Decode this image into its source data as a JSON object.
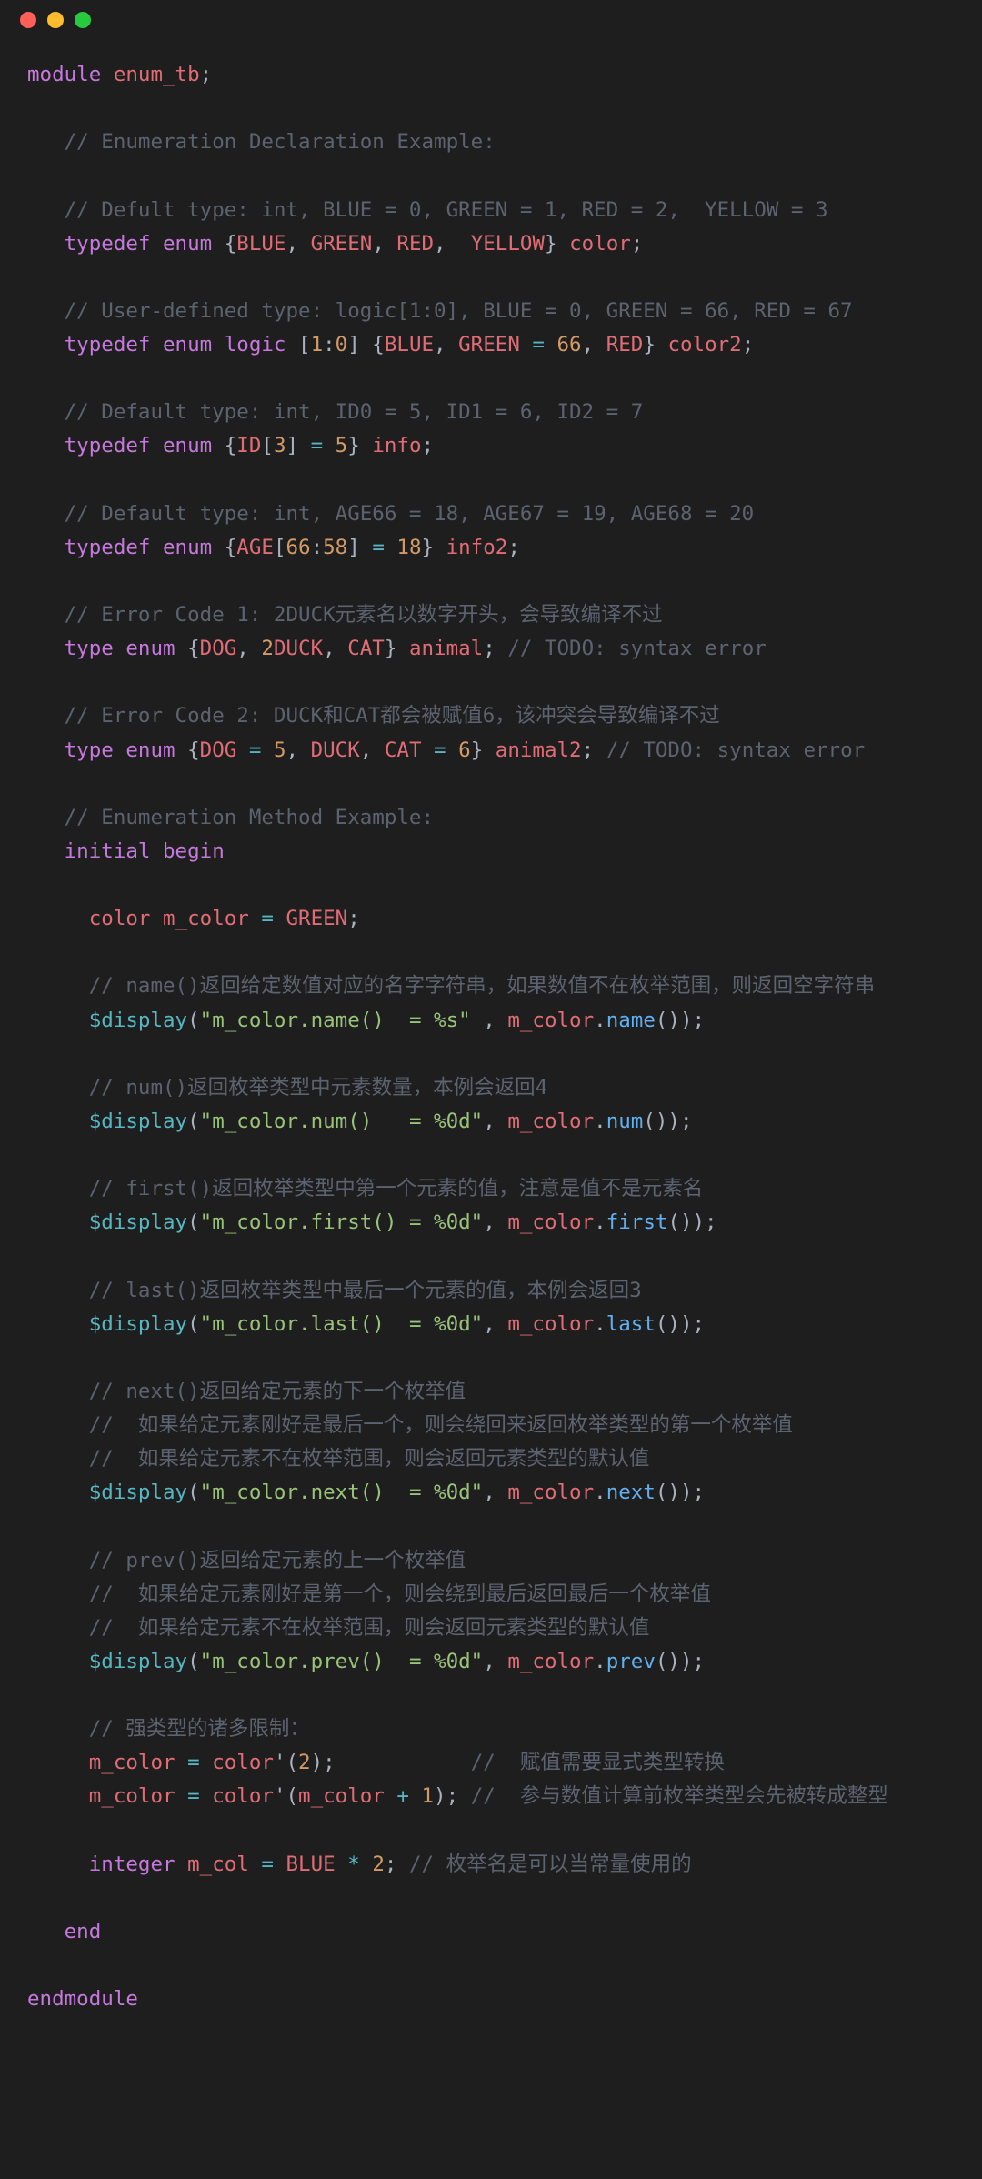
{
  "titlebar": {
    "dots": [
      "red",
      "yellow",
      "green"
    ]
  },
  "code": {
    "lines": [
      [
        [
          "kw",
          "module"
        ],
        [
          "punct",
          " "
        ],
        [
          "ident",
          "enum_tb"
        ],
        [
          "punct",
          ";"
        ]
      ],
      [],
      [
        [
          "punct",
          "   "
        ],
        [
          "comment",
          "// Enumeration Declaration Example:"
        ]
      ],
      [],
      [
        [
          "punct",
          "   "
        ],
        [
          "comment",
          "// Defult type: int, BLUE = 0, GREEN = 1, RED = 2,  YELLOW = 3"
        ]
      ],
      [
        [
          "punct",
          "   "
        ],
        [
          "kw",
          "typedef"
        ],
        [
          "punct",
          " "
        ],
        [
          "kw",
          "enum"
        ],
        [
          "punct",
          " {"
        ],
        [
          "ident",
          "BLUE"
        ],
        [
          "punct",
          ", "
        ],
        [
          "ident",
          "GREEN"
        ],
        [
          "punct",
          ", "
        ],
        [
          "ident",
          "RED"
        ],
        [
          "punct",
          ",  "
        ],
        [
          "ident",
          "YELLOW"
        ],
        [
          "punct",
          "} "
        ],
        [
          "ident",
          "color"
        ],
        [
          "punct",
          ";"
        ]
      ],
      [],
      [
        [
          "punct",
          "   "
        ],
        [
          "comment",
          "// User-defined type: logic[1:0], BLUE = 0, GREEN = 66, RED = 67"
        ]
      ],
      [
        [
          "punct",
          "   "
        ],
        [
          "kw",
          "typedef"
        ],
        [
          "punct",
          " "
        ],
        [
          "kw",
          "enum"
        ],
        [
          "punct",
          " "
        ],
        [
          "kw",
          "logic"
        ],
        [
          "punct",
          " ["
        ],
        [
          "num",
          "1"
        ],
        [
          "punct",
          ":"
        ],
        [
          "num",
          "0"
        ],
        [
          "punct",
          "] {"
        ],
        [
          "ident",
          "BLUE"
        ],
        [
          "punct",
          ", "
        ],
        [
          "ident",
          "GREEN"
        ],
        [
          "punct",
          " "
        ],
        [
          "op",
          "="
        ],
        [
          "punct",
          " "
        ],
        [
          "num",
          "66"
        ],
        [
          "punct",
          ", "
        ],
        [
          "ident",
          "RED"
        ],
        [
          "punct",
          "} "
        ],
        [
          "ident",
          "color2"
        ],
        [
          "punct",
          ";"
        ]
      ],
      [],
      [
        [
          "punct",
          "   "
        ],
        [
          "comment",
          "// Default type: int, ID0 = 5, ID1 = 6, ID2 = 7"
        ]
      ],
      [
        [
          "punct",
          "   "
        ],
        [
          "kw",
          "typedef"
        ],
        [
          "punct",
          " "
        ],
        [
          "kw",
          "enum"
        ],
        [
          "punct",
          " {"
        ],
        [
          "ident",
          "ID"
        ],
        [
          "punct",
          "["
        ],
        [
          "num",
          "3"
        ],
        [
          "punct",
          "] "
        ],
        [
          "op",
          "="
        ],
        [
          "punct",
          " "
        ],
        [
          "num",
          "5"
        ],
        [
          "punct",
          "} "
        ],
        [
          "ident",
          "info"
        ],
        [
          "punct",
          ";"
        ]
      ],
      [],
      [
        [
          "punct",
          "   "
        ],
        [
          "comment",
          "// Default type: int, AGE66 = 18, AGE67 = 19, AGE68 = 20"
        ]
      ],
      [
        [
          "punct",
          "   "
        ],
        [
          "kw",
          "typedef"
        ],
        [
          "punct",
          " "
        ],
        [
          "kw",
          "enum"
        ],
        [
          "punct",
          " {"
        ],
        [
          "ident",
          "AGE"
        ],
        [
          "punct",
          "["
        ],
        [
          "num",
          "66"
        ],
        [
          "punct",
          ":"
        ],
        [
          "num",
          "58"
        ],
        [
          "punct",
          "] "
        ],
        [
          "op",
          "="
        ],
        [
          "punct",
          " "
        ],
        [
          "num",
          "18"
        ],
        [
          "punct",
          "} "
        ],
        [
          "ident",
          "info2"
        ],
        [
          "punct",
          ";"
        ]
      ],
      [],
      [
        [
          "punct",
          "   "
        ],
        [
          "comment",
          "// Error Code 1: 2DUCK元素名以数字开头，会导致编译不过"
        ]
      ],
      [
        [
          "punct",
          "   "
        ],
        [
          "kw",
          "type"
        ],
        [
          "punct",
          " "
        ],
        [
          "kw",
          "enum"
        ],
        [
          "punct",
          " {"
        ],
        [
          "ident",
          "DOG"
        ],
        [
          "punct",
          ", "
        ],
        [
          "num",
          "2"
        ],
        [
          "ident",
          "DUCK"
        ],
        [
          "punct",
          ", "
        ],
        [
          "ident",
          "CAT"
        ],
        [
          "punct",
          "} "
        ],
        [
          "ident",
          "animal"
        ],
        [
          "punct",
          "; "
        ],
        [
          "comment",
          "// TODO: syntax error"
        ]
      ],
      [],
      [
        [
          "punct",
          "   "
        ],
        [
          "comment",
          "// Error Code 2: DUCK和CAT都会被赋值6，该冲突会导致编译不过"
        ]
      ],
      [
        [
          "punct",
          "   "
        ],
        [
          "kw",
          "type"
        ],
        [
          "punct",
          " "
        ],
        [
          "kw",
          "enum"
        ],
        [
          "punct",
          " {"
        ],
        [
          "ident",
          "DOG"
        ],
        [
          "punct",
          " "
        ],
        [
          "op",
          "="
        ],
        [
          "punct",
          " "
        ],
        [
          "num",
          "5"
        ],
        [
          "punct",
          ", "
        ],
        [
          "ident",
          "DUCK"
        ],
        [
          "punct",
          ", "
        ],
        [
          "ident",
          "CAT"
        ],
        [
          "punct",
          " "
        ],
        [
          "op",
          "="
        ],
        [
          "punct",
          " "
        ],
        [
          "num",
          "6"
        ],
        [
          "punct",
          "} "
        ],
        [
          "ident",
          "animal2"
        ],
        [
          "punct",
          "; "
        ],
        [
          "comment",
          "// TODO: syntax error"
        ]
      ],
      [],
      [
        [
          "punct",
          "   "
        ],
        [
          "comment",
          "// Enumeration Method Example:"
        ]
      ],
      [
        [
          "punct",
          "   "
        ],
        [
          "kw",
          "initial"
        ],
        [
          "punct",
          " "
        ],
        [
          "kw",
          "begin"
        ]
      ],
      [],
      [
        [
          "punct",
          "     "
        ],
        [
          "ident",
          "color"
        ],
        [
          "punct",
          " "
        ],
        [
          "ident",
          "m_color"
        ],
        [
          "punct",
          " "
        ],
        [
          "op",
          "="
        ],
        [
          "punct",
          " "
        ],
        [
          "ident",
          "GREEN"
        ],
        [
          "punct",
          ";"
        ]
      ],
      [],
      [
        [
          "punct",
          "     "
        ],
        [
          "comment",
          "// name()返回给定数值对应的名字字符串，如果数值不在枚举范围，则返回空字符串"
        ]
      ],
      [
        [
          "punct",
          "     "
        ],
        [
          "builtin",
          "$display"
        ],
        [
          "punct",
          "("
        ],
        [
          "str",
          "\"m_color.name()  = %s\""
        ],
        [
          "punct",
          " , "
        ],
        [
          "ident",
          "m_color"
        ],
        [
          "punct",
          "."
        ],
        [
          "func",
          "name"
        ],
        [
          "punct",
          "());"
        ]
      ],
      [],
      [
        [
          "punct",
          "     "
        ],
        [
          "comment",
          "// num()返回枚举类型中元素数量，本例会返回4"
        ]
      ],
      [
        [
          "punct",
          "     "
        ],
        [
          "builtin",
          "$display"
        ],
        [
          "punct",
          "("
        ],
        [
          "str",
          "\"m_color.num()   = %0d\""
        ],
        [
          "punct",
          ", "
        ],
        [
          "ident",
          "m_color"
        ],
        [
          "punct",
          "."
        ],
        [
          "func",
          "num"
        ],
        [
          "punct",
          "());"
        ]
      ],
      [],
      [
        [
          "punct",
          "     "
        ],
        [
          "comment",
          "// first()返回枚举类型中第一个元素的值，注意是值不是元素名"
        ]
      ],
      [
        [
          "punct",
          "     "
        ],
        [
          "builtin",
          "$display"
        ],
        [
          "punct",
          "("
        ],
        [
          "str",
          "\"m_color.first() = %0d\""
        ],
        [
          "punct",
          ", "
        ],
        [
          "ident",
          "m_color"
        ],
        [
          "punct",
          "."
        ],
        [
          "func",
          "first"
        ],
        [
          "punct",
          "());"
        ]
      ],
      [],
      [
        [
          "punct",
          "     "
        ],
        [
          "comment",
          "// last()返回枚举类型中最后一个元素的值，本例会返回3"
        ]
      ],
      [
        [
          "punct",
          "     "
        ],
        [
          "builtin",
          "$display"
        ],
        [
          "punct",
          "("
        ],
        [
          "str",
          "\"m_color.last()  = %0d\""
        ],
        [
          "punct",
          ", "
        ],
        [
          "ident",
          "m_color"
        ],
        [
          "punct",
          "."
        ],
        [
          "func",
          "last"
        ],
        [
          "punct",
          "());"
        ]
      ],
      [],
      [
        [
          "punct",
          "     "
        ],
        [
          "comment",
          "// next()返回给定元素的下一个枚举值"
        ]
      ],
      [
        [
          "punct",
          "     "
        ],
        [
          "comment",
          "//  如果给定元素刚好是最后一个，则会绕回来返回枚举类型的第一个枚举值"
        ]
      ],
      [
        [
          "punct",
          "     "
        ],
        [
          "comment",
          "//  如果给定元素不在枚举范围，则会返回元素类型的默认值"
        ]
      ],
      [
        [
          "punct",
          "     "
        ],
        [
          "builtin",
          "$display"
        ],
        [
          "punct",
          "("
        ],
        [
          "str",
          "\"m_color.next()  = %0d\""
        ],
        [
          "punct",
          ", "
        ],
        [
          "ident",
          "m_color"
        ],
        [
          "punct",
          "."
        ],
        [
          "func",
          "next"
        ],
        [
          "punct",
          "());"
        ]
      ],
      [],
      [
        [
          "punct",
          "     "
        ],
        [
          "comment",
          "// prev()返回给定元素的上一个枚举值"
        ]
      ],
      [
        [
          "punct",
          "     "
        ],
        [
          "comment",
          "//  如果给定元素刚好是第一个，则会绕到最后返回最后一个枚举值"
        ]
      ],
      [
        [
          "punct",
          "     "
        ],
        [
          "comment",
          "//  如果给定元素不在枚举范围，则会返回元素类型的默认值"
        ]
      ],
      [
        [
          "punct",
          "     "
        ],
        [
          "builtin",
          "$display"
        ],
        [
          "punct",
          "("
        ],
        [
          "str",
          "\"m_color.prev()  = %0d\""
        ],
        [
          "punct",
          ", "
        ],
        [
          "ident",
          "m_color"
        ],
        [
          "punct",
          "."
        ],
        [
          "func",
          "prev"
        ],
        [
          "punct",
          "());"
        ]
      ],
      [],
      [
        [
          "punct",
          "     "
        ],
        [
          "comment",
          "// 强类型的诸多限制："
        ]
      ],
      [
        [
          "punct",
          "     "
        ],
        [
          "ident",
          "m_color"
        ],
        [
          "punct",
          " "
        ],
        [
          "op",
          "="
        ],
        [
          "punct",
          " "
        ],
        [
          "ident",
          "color"
        ],
        [
          "punct",
          "'("
        ],
        [
          "num",
          "2"
        ],
        [
          "punct",
          ");           "
        ],
        [
          "comment",
          "//  赋值需要显式类型转换"
        ]
      ],
      [
        [
          "punct",
          "     "
        ],
        [
          "ident",
          "m_color"
        ],
        [
          "punct",
          " "
        ],
        [
          "op",
          "="
        ],
        [
          "punct",
          " "
        ],
        [
          "ident",
          "color"
        ],
        [
          "punct",
          "'("
        ],
        [
          "ident",
          "m_color"
        ],
        [
          "punct",
          " "
        ],
        [
          "op",
          "+"
        ],
        [
          "punct",
          " "
        ],
        [
          "num",
          "1"
        ],
        [
          "punct",
          "); "
        ],
        [
          "comment",
          "//  参与数值计算前枚举类型会先被转成整型"
        ]
      ],
      [],
      [
        [
          "punct",
          "     "
        ],
        [
          "kw",
          "integer"
        ],
        [
          "punct",
          " "
        ],
        [
          "ident",
          "m_col"
        ],
        [
          "punct",
          " "
        ],
        [
          "op",
          "="
        ],
        [
          "punct",
          " "
        ],
        [
          "ident",
          "BLUE"
        ],
        [
          "punct",
          " "
        ],
        [
          "op",
          "*"
        ],
        [
          "punct",
          " "
        ],
        [
          "num",
          "2"
        ],
        [
          "punct",
          "; "
        ],
        [
          "comment",
          "// 枚举名是可以当常量使用的"
        ]
      ],
      [],
      [
        [
          "punct",
          "   "
        ],
        [
          "kw",
          "end"
        ]
      ],
      [],
      [
        [
          "kw",
          "endmodule"
        ]
      ]
    ]
  }
}
